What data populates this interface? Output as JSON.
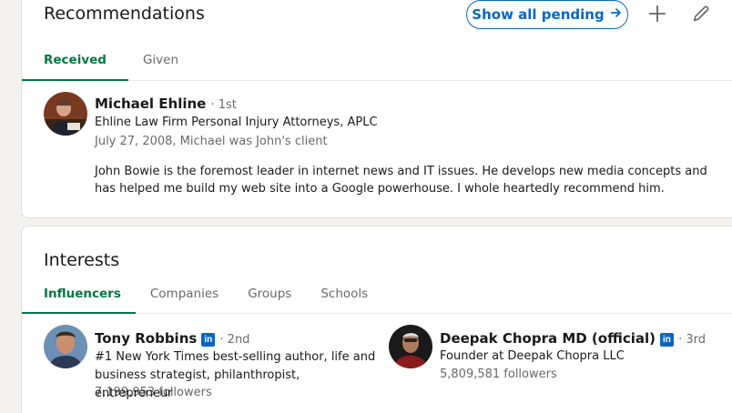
{
  "recommendations": {
    "title": "Recommendations",
    "show_all_label": "Show all pending",
    "add_icon": "plus-icon",
    "edit_icon": "pencil-icon",
    "tabs": [
      {
        "label": "Received",
        "active": true
      },
      {
        "label": "Given",
        "active": false
      }
    ],
    "item": {
      "name": "Michael Ehline",
      "degree": "· 1st",
      "headline": "Ehline Law Firm Personal Injury Attorneys, APLC",
      "meta": "July 27, 2008, Michael was John's client",
      "text": "John Bowie is the foremost leader in internet news and IT issues. He develops new media concepts and has helped me build my web site into a Google powerhouse. I whole heartedly recommend him."
    }
  },
  "interests": {
    "title": "Interests",
    "tabs": [
      {
        "label": "Influencers",
        "active": true
      },
      {
        "label": "Companies",
        "active": false
      },
      {
        "label": "Groups",
        "active": false
      },
      {
        "label": "Schools",
        "active": false
      }
    ],
    "influencers": [
      {
        "name": "Tony Robbins",
        "badge": "in",
        "degree": "· 2nd",
        "headline": "#1 New York Times best-selling author, life and business strategist, philanthropist, entrepreneur",
        "followers": "7,199,953 followers"
      },
      {
        "name": "Deepak Chopra MD (official)",
        "badge": "in",
        "degree": "· 3rd",
        "headline": "Founder at Deepak Chopra LLC",
        "followers": "5,809,581 followers"
      }
    ]
  },
  "colors": {
    "accent_green": "#057642",
    "link_blue": "#0a66c2",
    "page_bg": "#f3f2ef"
  }
}
